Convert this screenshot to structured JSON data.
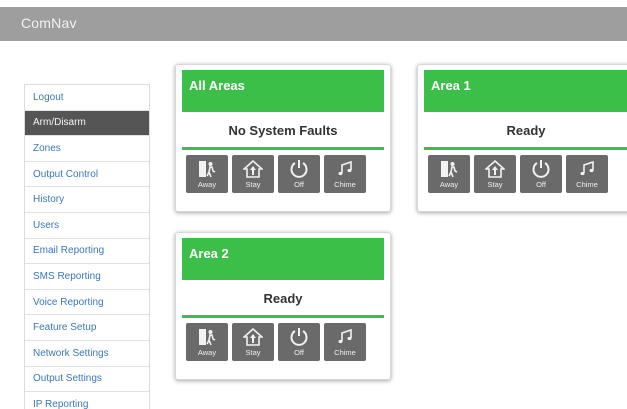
{
  "app": {
    "title": "ComNav"
  },
  "sidebar": {
    "items": [
      {
        "label": "Logout",
        "active": false
      },
      {
        "label": "Arm/Disarm",
        "active": true
      },
      {
        "label": "Zones",
        "active": false
      },
      {
        "label": "Output Control",
        "active": false
      },
      {
        "label": "History",
        "active": false
      },
      {
        "label": "Users",
        "active": false
      },
      {
        "label": "Email Reporting",
        "active": false
      },
      {
        "label": "SMS Reporting",
        "active": false
      },
      {
        "label": "Voice Reporting",
        "active": false
      },
      {
        "label": "Feature Setup",
        "active": false
      },
      {
        "label": "Network Settings",
        "active": false
      },
      {
        "label": "Output Settings",
        "active": false
      },
      {
        "label": "IP Reporting",
        "active": false
      }
    ]
  },
  "actions": {
    "away": "Away",
    "stay": "Stay",
    "off": "Off",
    "chime": "Chime"
  },
  "areas": [
    {
      "title": "All Areas",
      "status": "No System Faults"
    },
    {
      "title": "Area 1",
      "status": "Ready"
    },
    {
      "title": "Area 2",
      "status": "Ready"
    }
  ],
  "colors": {
    "topbar": "#9e9e9e",
    "accent": "#3cbf48",
    "active_nav": "#555555",
    "button": "#6a6a6a",
    "link": "#3a78b5"
  }
}
